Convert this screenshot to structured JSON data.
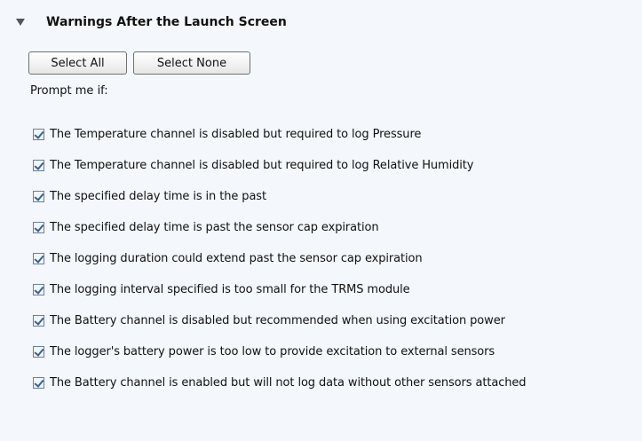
{
  "section": {
    "title": "Warnings After the Launch Screen",
    "expanded_icon": "triangle-down-icon"
  },
  "buttons": {
    "select_all": "Select All",
    "select_none": "Select None"
  },
  "prompt_label": "Prompt me if:",
  "warnings": [
    {
      "label": "The Temperature channel is disabled but required to log Pressure",
      "checked": true
    },
    {
      "label": "The Temperature channel is disabled but required to log Relative Humidity",
      "checked": true
    },
    {
      "label": "The specified delay time is in the past",
      "checked": true
    },
    {
      "label": "The specified delay time is past the sensor cap expiration",
      "checked": true
    },
    {
      "label": "The logging duration could extend past the sensor cap expiration",
      "checked": true
    },
    {
      "label": "The logging interval specified is too small for the TRMS module",
      "checked": true
    },
    {
      "label": "The Battery channel is disabled but recommended when using excitation power",
      "checked": true
    },
    {
      "label": "The logger's battery power is too low to provide excitation to external sensors",
      "checked": true
    },
    {
      "label": "The Battery channel is enabled but will not log data without other sensors attached",
      "checked": true
    }
  ],
  "colors": {
    "background": "#f4f7fb",
    "checkbox_check": "#3e5f8a",
    "checkbox_border": "#6b7f95"
  }
}
